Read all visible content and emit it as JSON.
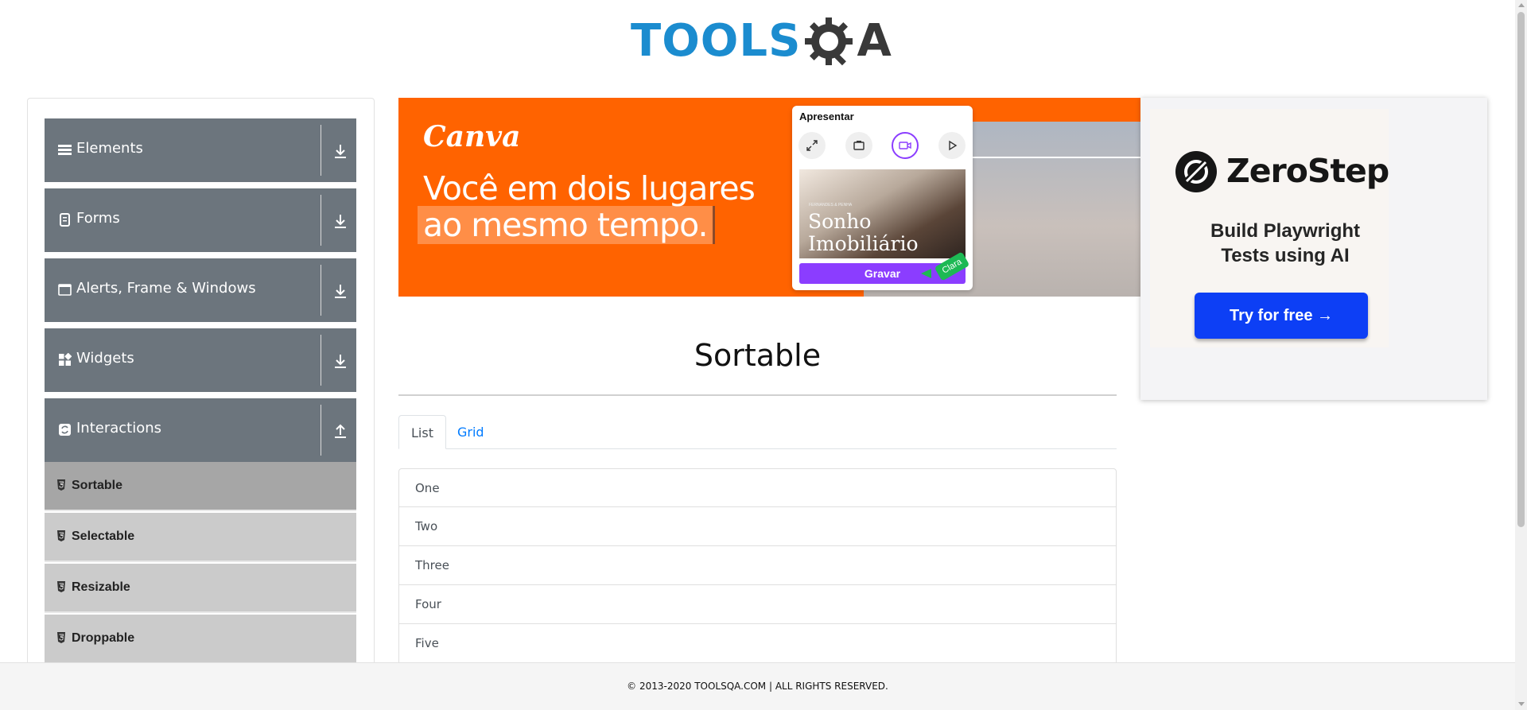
{
  "header": {
    "logo_text": "TOOLS",
    "logo_tail": "A",
    "logo_icon": "gear-q-icon"
  },
  "sidebar": {
    "groups": [
      {
        "label": "Elements",
        "icon": "hamburger-icon",
        "arrow": "download-arrow-icon"
      },
      {
        "label": "Forms",
        "icon": "form-icon",
        "arrow": "download-arrow-icon"
      },
      {
        "label": "Alerts, Frame & Windows",
        "icon": "window-icon",
        "arrow": "download-arrow-icon"
      },
      {
        "label": "Widgets",
        "icon": "widgets-icon",
        "arrow": "download-arrow-icon"
      },
      {
        "label": "Interactions",
        "icon": "interactions-icon",
        "arrow": "upload-arrow-icon"
      }
    ],
    "subitems": [
      {
        "label": "Sortable",
        "active": true
      },
      {
        "label": "Selectable"
      },
      {
        "label": "Resizable"
      },
      {
        "label": "Droppable"
      }
    ]
  },
  "ad_canva": {
    "brand": "Canva",
    "headline_1": "Você em dois lugares",
    "headline_2": "ao mesmo tempo.",
    "card_title": "Apresentar",
    "thumb_small": "FERNANDES & PENHA",
    "thumb_title_1": "Sonho",
    "thumb_title_2": "Imobiliário",
    "record_label": "Gravar",
    "cursor_name": "Clara",
    "accent": "#ff6300",
    "purple": "#8b3dff"
  },
  "ad_zerostep": {
    "brand": "ZeroStep",
    "tagline_1": "Build Playwright",
    "tagline_2": "Tests using AI",
    "cta": "Try for free →",
    "cta_color": "#0d3ff5"
  },
  "main": {
    "title": "Sortable",
    "tabs": [
      {
        "label": "List",
        "active": true
      },
      {
        "label": "Grid",
        "active": false
      }
    ],
    "items": [
      "One",
      "Two",
      "Three",
      "Four",
      "Five"
    ]
  },
  "footer": {
    "text": "© 2013-2020 TOOLSQA.COM | ALL RIGHTS RESERVED."
  },
  "colors": {
    "sidebar_group": "#6c757d",
    "sidebar_sub": "#cbcbcb",
    "sidebar_sub_active": "#a6a6a6",
    "link": "#007bff",
    "logo_blue": "#1b8ccf"
  }
}
